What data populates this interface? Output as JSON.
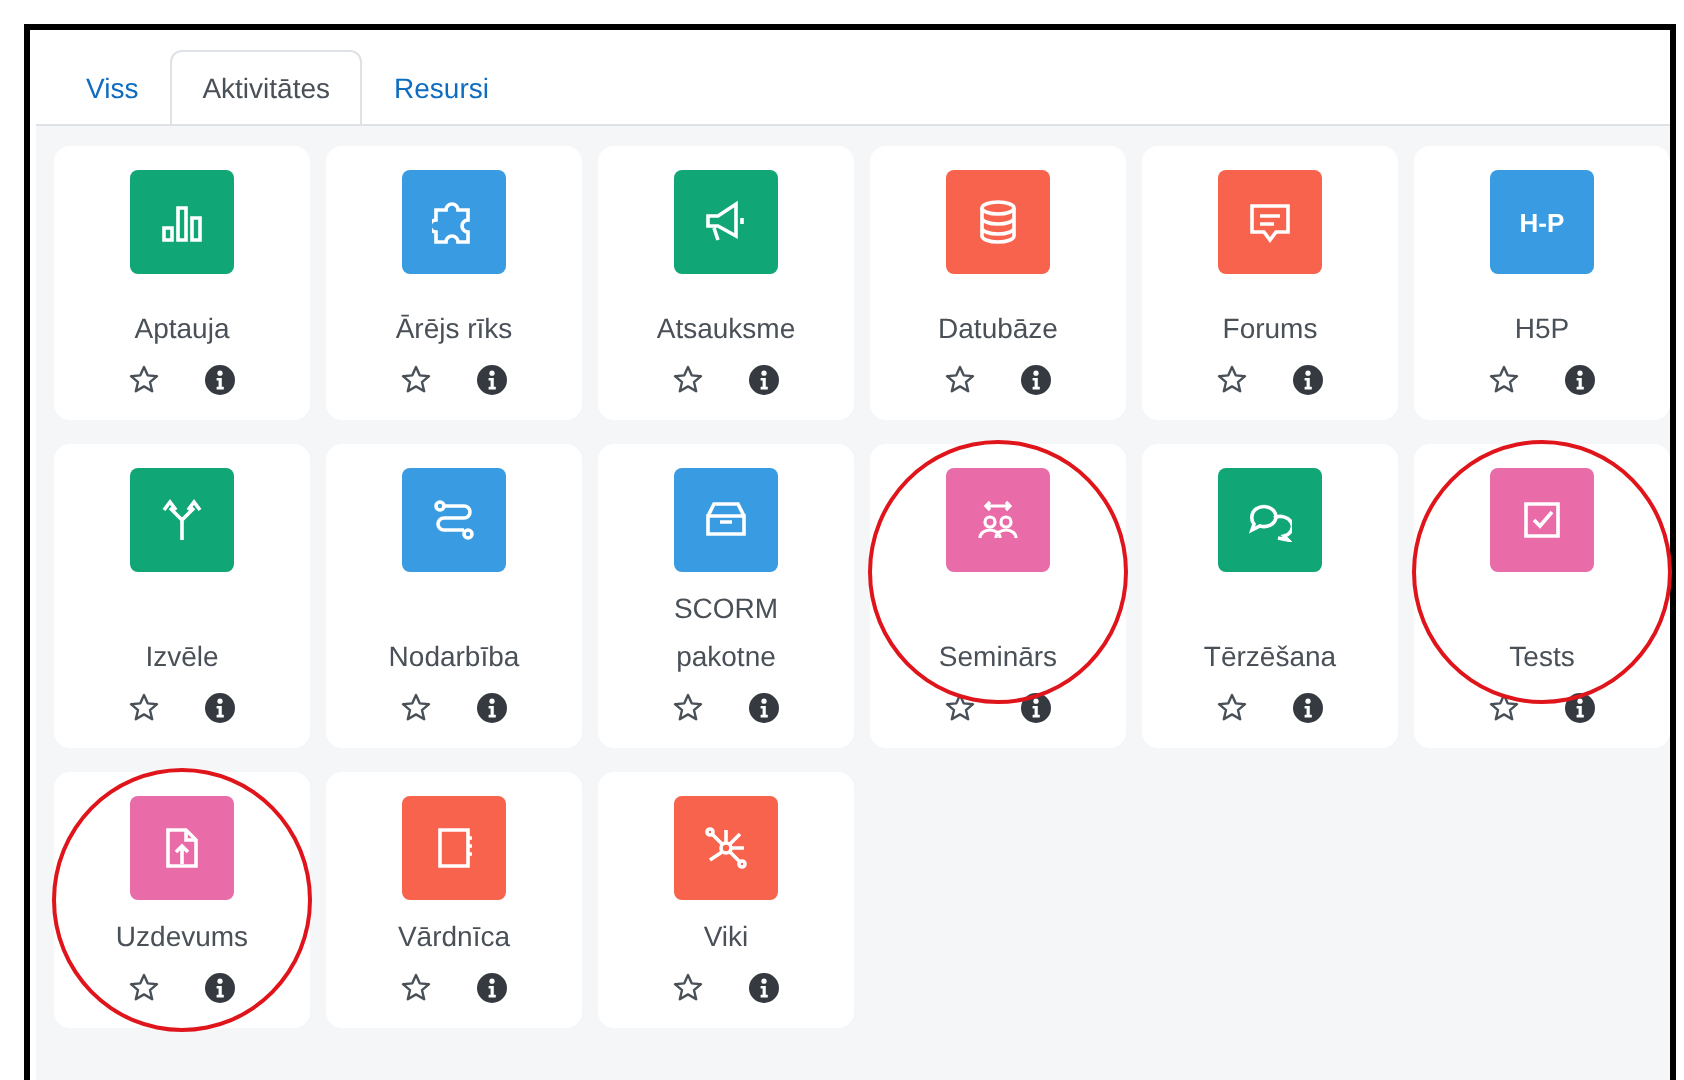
{
  "tabs": [
    {
      "label": "Viss",
      "selected": false
    },
    {
      "label": "Aktivitātes",
      "selected": true
    },
    {
      "label": "Resursi",
      "selected": false
    }
  ],
  "activities": [
    {
      "name": "Aptauja",
      "color": "#11a676",
      "circled": false
    },
    {
      "name": "Ārējs rīks",
      "color": "#399be2",
      "circled": false
    },
    {
      "name": "Atsauksme",
      "color": "#11a676",
      "circled": false
    },
    {
      "name": "Datubāze",
      "color": "#f7634d",
      "circled": false
    },
    {
      "name": "Forums",
      "color": "#f7634d",
      "circled": false
    },
    {
      "name": "H5P",
      "color": "#399be2",
      "circled": false,
      "icon_text": "H-P"
    },
    {
      "name": "Izvēle",
      "color": "#11a676",
      "circled": false
    },
    {
      "name": "Nodarbība",
      "color": "#399be2",
      "circled": false
    },
    {
      "name": "SCORM pakotne",
      "color": "#399be2",
      "circled": false
    },
    {
      "name": "Seminārs",
      "color": "#e96ba8",
      "circled": true
    },
    {
      "name": "Tērzēšana",
      "color": "#11a676",
      "circled": false
    },
    {
      "name": "Tests",
      "color": "#e96ba8",
      "circled": true
    },
    {
      "name": "Uzdevums",
      "color": "#e96ba8",
      "circled": true
    },
    {
      "name": "Vārdnīca",
      "color": "#f7634d",
      "circled": false
    },
    {
      "name": "Viki",
      "color": "#f7634d",
      "circled": false
    }
  ]
}
